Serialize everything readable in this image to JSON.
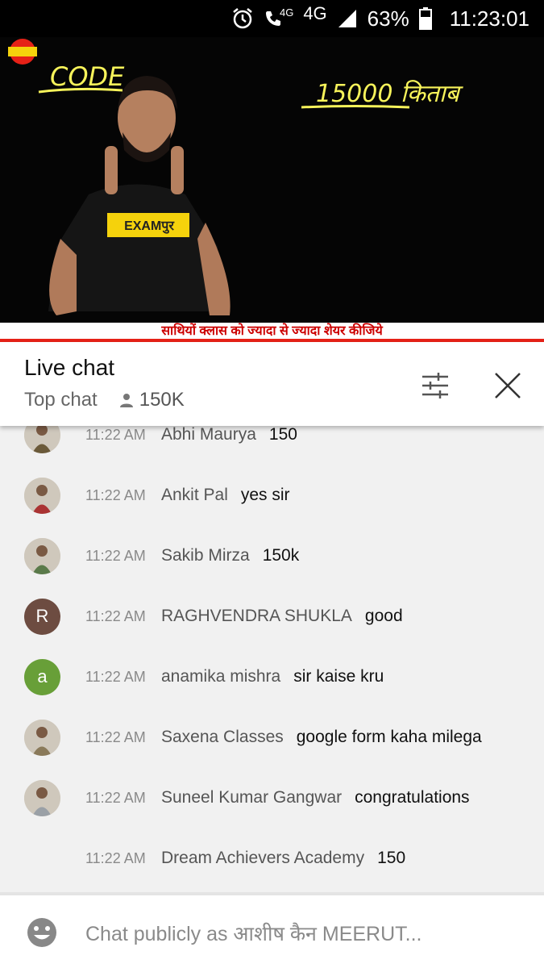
{
  "status_bar": {
    "network_small": "4G",
    "network": "4G",
    "battery": "63%",
    "time": "11:23:01"
  },
  "video": {
    "board_left": "CODE",
    "board_right": "15000 किताब",
    "shirt_logo": "EXAMपुर",
    "ticker": "साथियों क्लास को ज्यादा से ज्यादा शेयर कीजिये"
  },
  "chat_header": {
    "title": "Live chat",
    "mode": "Top chat",
    "viewers": "150K"
  },
  "messages": [
    {
      "time": "11:22 AM",
      "author": "Abhi Maurya",
      "text": "150",
      "avatar": "photo",
      "avatar_color": "#6b5a3a"
    },
    {
      "time": "11:22 AM",
      "author": "Ankit Pal",
      "text": "yes sir",
      "avatar": "photo",
      "avatar_color": "#a33"
    },
    {
      "time": "11:22 AM",
      "author": "Sakib Mirza",
      "text": "150k",
      "avatar": "photo",
      "avatar_color": "#5a7a4a"
    },
    {
      "time": "11:22 AM",
      "author": "RAGHVENDRA SHUKLA",
      "text": "good",
      "avatar": "R",
      "avatar_color": "#6d4c41"
    },
    {
      "time": "11:22 AM",
      "author": "anamika mishra",
      "text": "sir kaise kru",
      "avatar": "a",
      "avatar_color": "#689f38"
    },
    {
      "time": "11:22 AM",
      "author": "Saxena Classes",
      "text": "google form kaha milega",
      "avatar": "photo",
      "avatar_color": "#8a7a5a"
    },
    {
      "time": "11:22 AM",
      "author": "Suneel Kumar Gangwar",
      "text": "congratulations",
      "avatar": "photo",
      "avatar_color": "#9aa0a6"
    },
    {
      "time": "11:22 AM",
      "author": "Dream Achievers Academy",
      "text": "150",
      "avatar": "none",
      "avatar_color": ""
    }
  ],
  "input": {
    "placeholder": "Chat publicly as आशीष कैन MEERUT..."
  },
  "colors": {
    "accent_red": "#e62117",
    "board_yellow": "#f7f35a"
  }
}
